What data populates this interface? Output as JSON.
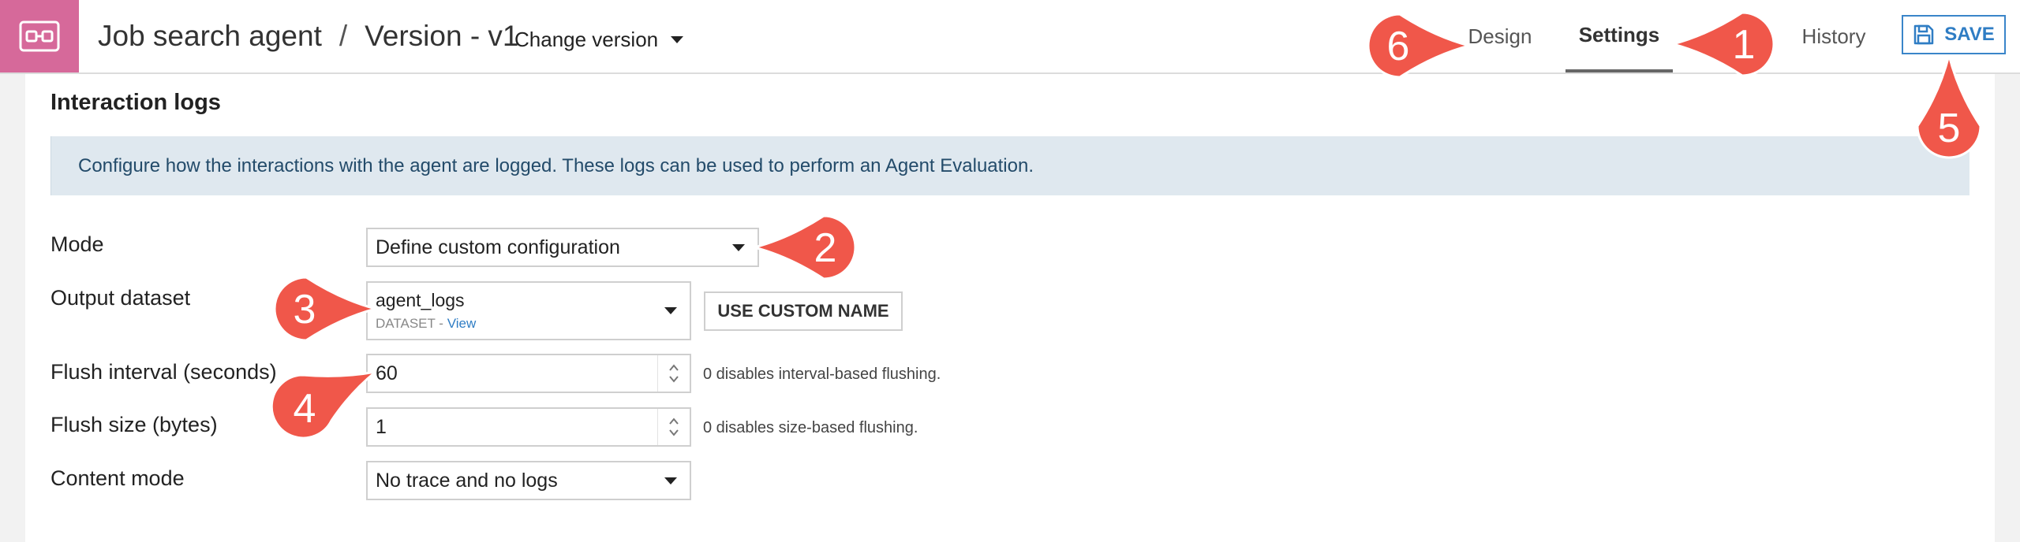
{
  "header": {
    "breadcrumb": [
      "Job search agent",
      "Version - v1"
    ],
    "breadcrumb_separator": "/",
    "change_version_label": "Change version",
    "tabs": [
      {
        "label": "Design",
        "active": false
      },
      {
        "label": "Settings",
        "active": true
      },
      {
        "label": "History",
        "active": false
      }
    ],
    "save_label": "SAVE"
  },
  "section": {
    "title": "Interaction logs",
    "banner_text": "Configure how the interactions with the agent are logged. These logs can be used to perform an Agent Evaluation."
  },
  "form": {
    "mode": {
      "label": "Mode",
      "value": "Define custom configuration"
    },
    "output_dataset": {
      "label": "Output dataset",
      "value": "agent_logs",
      "type_label": "DATASET",
      "type_sep": " - ",
      "link_label": "View",
      "custom_name_button": "USE CUSTOM NAME"
    },
    "flush_interval": {
      "label": "Flush interval (seconds)",
      "value": "60",
      "hint": "0 disables interval-based flushing."
    },
    "flush_size": {
      "label": "Flush size (bytes)",
      "value": "1",
      "hint": "0 disables size-based flushing."
    },
    "content_mode": {
      "label": "Content mode",
      "value": "No trace and no logs"
    }
  },
  "annotations": [
    "1",
    "2",
    "3",
    "4",
    "5",
    "6"
  ],
  "colors": {
    "app_icon_bg": "#d6699a",
    "accent_blue": "#2f7dc4",
    "banner_bg": "#dfe8ef",
    "callout_red": "#f0574a"
  }
}
